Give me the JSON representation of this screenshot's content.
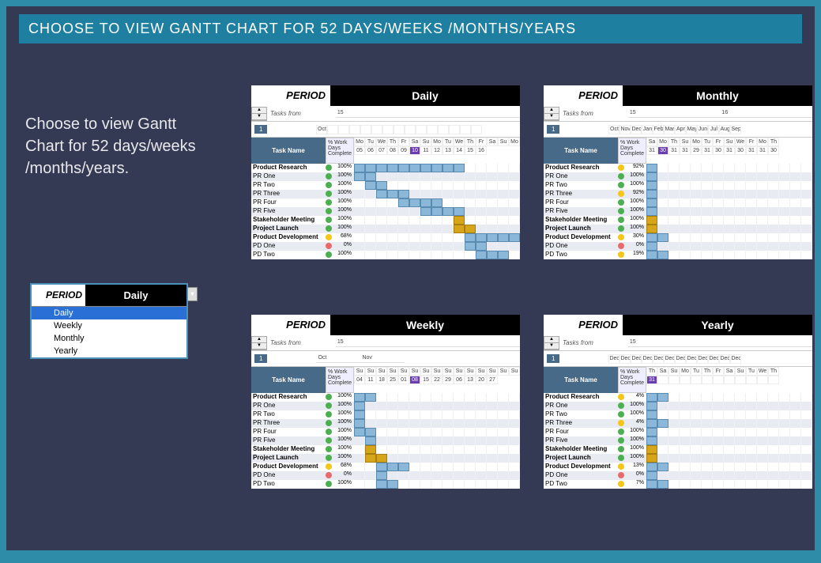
{
  "title": "CHOOSE TO VIEW GANTT CHART FOR 52 DAYS/WEEKS /MONTHS/YEARS",
  "intro": "Choose to view Gantt Chart for 52 days/weeks /months/years.",
  "period_label": "PERIOD",
  "selector": {
    "value": "Daily",
    "options": [
      "Daily",
      "Weekly",
      "Monthly",
      "Yearly"
    ]
  },
  "header": {
    "tasks_from": "Tasks from",
    "task_name": "Task Name",
    "work_days": "% Work Days Complete",
    "spinner_val": "1"
  },
  "panels": {
    "daily": {
      "value": "Daily",
      "super": "15",
      "date_top": [
        "Oct",
        "",
        "",
        "",
        "",
        "",
        "",
        "",
        "",
        "",
        "",
        "",
        "",
        "",
        ""
      ],
      "dates": [
        "Mo",
        "Tu",
        "We",
        "Th",
        "Fr",
        "Sa",
        "Su",
        "Mo",
        "Tu",
        "We",
        "Th",
        "Fr",
        "Sa",
        "Su",
        "Mo"
      ],
      "nums": [
        "05",
        "06",
        "07",
        "08",
        "09",
        "10",
        "11",
        "12",
        "13",
        "14",
        "15",
        "16"
      ],
      "mark_idx": 5
    },
    "weekly": {
      "value": "Weekly",
      "super": "15",
      "date_top_groups": [
        "Oct",
        "Nov"
      ],
      "dates": [
        "Su",
        "Su",
        "Su",
        "Su",
        "Su",
        "Su",
        "Su",
        "Su",
        "Su",
        "Su",
        "Su",
        "Su",
        "Su",
        "Su",
        "Su"
      ],
      "nums": [
        "04",
        "11",
        "18",
        "25",
        "01",
        "08",
        "15",
        "22",
        "29",
        "06",
        "13",
        "20",
        "27"
      ],
      "mark_idx": 5
    },
    "monthly": {
      "value": "Monthly",
      "super_groups": [
        "15",
        "16"
      ],
      "date_top": [
        "Oct",
        "Nov",
        "Dec",
        "Jan",
        "Feb",
        "Mar",
        "Apr",
        "May",
        "Jun",
        "Jul",
        "Aug",
        "Sep"
      ],
      "dates": [
        "Sa",
        "Mo",
        "Th",
        "Su",
        "Mo",
        "Tu",
        "Fr",
        "Su",
        "We",
        "Fr",
        "Mo",
        "Th"
      ],
      "nums": [
        "31",
        "30",
        "31",
        "31",
        "29",
        "31",
        "30",
        "31",
        "30",
        "31",
        "31",
        "30"
      ],
      "mark_idx": 1
    },
    "yearly": {
      "value": "Yearly",
      "super": "15",
      "date_top": [
        "Dec",
        "Dec",
        "Dec",
        "Dec",
        "Dec",
        "Dec",
        "Dec",
        "Dec",
        "Dec",
        "Dec",
        "Dec",
        "Dec"
      ],
      "dates": [
        "Th",
        "Sa",
        "Su",
        "Mo",
        "Tu",
        "Th",
        "Fr",
        "Sa",
        "Su",
        "Tu",
        "We",
        "Th"
      ],
      "nums": [
        "31",
        "",
        "",
        "",
        "",
        "",
        "",
        "",
        "",
        "",
        "",
        ""
      ],
      "mark_idx": 0
    }
  },
  "tasks_daily": [
    {
      "n": "Product Research",
      "b": true,
      "d": "g",
      "p": "100%",
      "bars": [
        0,
        1,
        2,
        3,
        4,
        5,
        6,
        7,
        8,
        9
      ]
    },
    {
      "n": "PR One",
      "b": false,
      "d": "g",
      "p": "100%",
      "bars": [
        0,
        1
      ]
    },
    {
      "n": "PR Two",
      "b": false,
      "d": "g",
      "p": "100%",
      "bars": [
        1,
        2
      ]
    },
    {
      "n": "PR Three",
      "b": false,
      "d": "g",
      "p": "100%",
      "bars": [
        2,
        3,
        4
      ]
    },
    {
      "n": "PR Four",
      "b": false,
      "d": "g",
      "p": "100%",
      "bars": [
        4,
        5,
        6,
        7
      ]
    },
    {
      "n": "PR Five",
      "b": false,
      "d": "g",
      "p": "100%",
      "bars": [
        6,
        7,
        8,
        9
      ]
    },
    {
      "n": "Stakeholder Meeting",
      "b": true,
      "d": "g",
      "p": "100%",
      "bars": [
        9
      ],
      "gold": true
    },
    {
      "n": "Project Launch",
      "b": true,
      "d": "g",
      "p": "100%",
      "bars": [
        9,
        10
      ],
      "gold": true
    },
    {
      "n": "Product Development",
      "b": true,
      "d": "y",
      "p": "68%",
      "bars": [
        10,
        11,
        12,
        13,
        14
      ]
    },
    {
      "n": "PD One",
      "b": false,
      "d": "r",
      "p": "0%",
      "bars": [
        10,
        11
      ]
    },
    {
      "n": "PD Two",
      "b": false,
      "d": "g",
      "p": "100%",
      "bars": [
        11,
        12,
        13
      ]
    }
  ],
  "tasks_weekly": [
    {
      "n": "Product Research",
      "b": true,
      "d": "g",
      "p": "100%",
      "bars": [
        0,
        1
      ]
    },
    {
      "n": "PR One",
      "b": false,
      "d": "g",
      "p": "100%",
      "bars": [
        0
      ]
    },
    {
      "n": "PR Two",
      "b": false,
      "d": "g",
      "p": "100%",
      "bars": [
        0
      ]
    },
    {
      "n": "PR Three",
      "b": false,
      "d": "g",
      "p": "100%",
      "bars": [
        0
      ]
    },
    {
      "n": "PR Four",
      "b": false,
      "d": "g",
      "p": "100%",
      "bars": [
        0,
        1
      ]
    },
    {
      "n": "PR Five",
      "b": false,
      "d": "g",
      "p": "100%",
      "bars": [
        1
      ]
    },
    {
      "n": "Stakeholder Meeting",
      "b": true,
      "d": "g",
      "p": "100%",
      "bars": [
        1
      ],
      "gold": true
    },
    {
      "n": "Project Launch",
      "b": true,
      "d": "g",
      "p": "100%",
      "bars": [
        1,
        2
      ],
      "gold": true
    },
    {
      "n": "Product Development",
      "b": true,
      "d": "y",
      "p": "68%",
      "bars": [
        2,
        3,
        4
      ]
    },
    {
      "n": "PD One",
      "b": false,
      "d": "r",
      "p": "0%",
      "bars": [
        2
      ]
    },
    {
      "n": "PD Two",
      "b": false,
      "d": "g",
      "p": "100%",
      "bars": [
        2,
        3
      ]
    }
  ],
  "tasks_monthly": [
    {
      "n": "Product Research",
      "b": true,
      "d": "y",
      "p": "92%",
      "bars": [
        0
      ]
    },
    {
      "n": "PR One",
      "b": false,
      "d": "g",
      "p": "100%",
      "bars": [
        0
      ]
    },
    {
      "n": "PR Two",
      "b": false,
      "d": "g",
      "p": "100%",
      "bars": [
        0
      ]
    },
    {
      "n": "PR Three",
      "b": false,
      "d": "y",
      "p": "92%",
      "bars": [
        0
      ]
    },
    {
      "n": "PR Four",
      "b": false,
      "d": "g",
      "p": "100%",
      "bars": [
        0
      ]
    },
    {
      "n": "PR Five",
      "b": false,
      "d": "g",
      "p": "100%",
      "bars": [
        0
      ]
    },
    {
      "n": "Stakeholder Meeting",
      "b": true,
      "d": "g",
      "p": "100%",
      "bars": [
        0
      ],
      "gold": true
    },
    {
      "n": "Project Launch",
      "b": true,
      "d": "g",
      "p": "100%",
      "bars": [
        0
      ],
      "gold": true
    },
    {
      "n": "Product Development",
      "b": true,
      "d": "y",
      "p": "30%",
      "bars": [
        0,
        1
      ]
    },
    {
      "n": "PD One",
      "b": false,
      "d": "r",
      "p": "0%",
      "bars": [
        0
      ]
    },
    {
      "n": "PD Two",
      "b": false,
      "d": "y",
      "p": "19%",
      "bars": [
        0,
        1
      ]
    }
  ],
  "tasks_yearly": [
    {
      "n": "Product Research",
      "b": true,
      "d": "y",
      "p": "4%",
      "bars": [
        0,
        1
      ]
    },
    {
      "n": "PR One",
      "b": false,
      "d": "g",
      "p": "100%",
      "bars": [
        0
      ]
    },
    {
      "n": "PR Two",
      "b": false,
      "d": "g",
      "p": "100%",
      "bars": [
        0
      ]
    },
    {
      "n": "PR Three",
      "b": false,
      "d": "y",
      "p": "4%",
      "bars": [
        0,
        1
      ]
    },
    {
      "n": "PR Four",
      "b": false,
      "d": "g",
      "p": "100%",
      "bars": [
        0
      ]
    },
    {
      "n": "PR Five",
      "b": false,
      "d": "g",
      "p": "100%",
      "bars": [
        0
      ]
    },
    {
      "n": "Stakeholder Meeting",
      "b": true,
      "d": "g",
      "p": "100%",
      "bars": [
        0
      ],
      "gold": true
    },
    {
      "n": "Project Launch",
      "b": true,
      "d": "g",
      "p": "100%",
      "bars": [
        0
      ],
      "gold": true
    },
    {
      "n": "Product Development",
      "b": true,
      "d": "y",
      "p": "13%",
      "bars": [
        0,
        1
      ]
    },
    {
      "n": "PD One",
      "b": false,
      "d": "r",
      "p": "0%",
      "bars": [
        0
      ]
    },
    {
      "n": "PD Two",
      "b": false,
      "d": "y",
      "p": "7%",
      "bars": [
        0,
        1
      ]
    }
  ]
}
